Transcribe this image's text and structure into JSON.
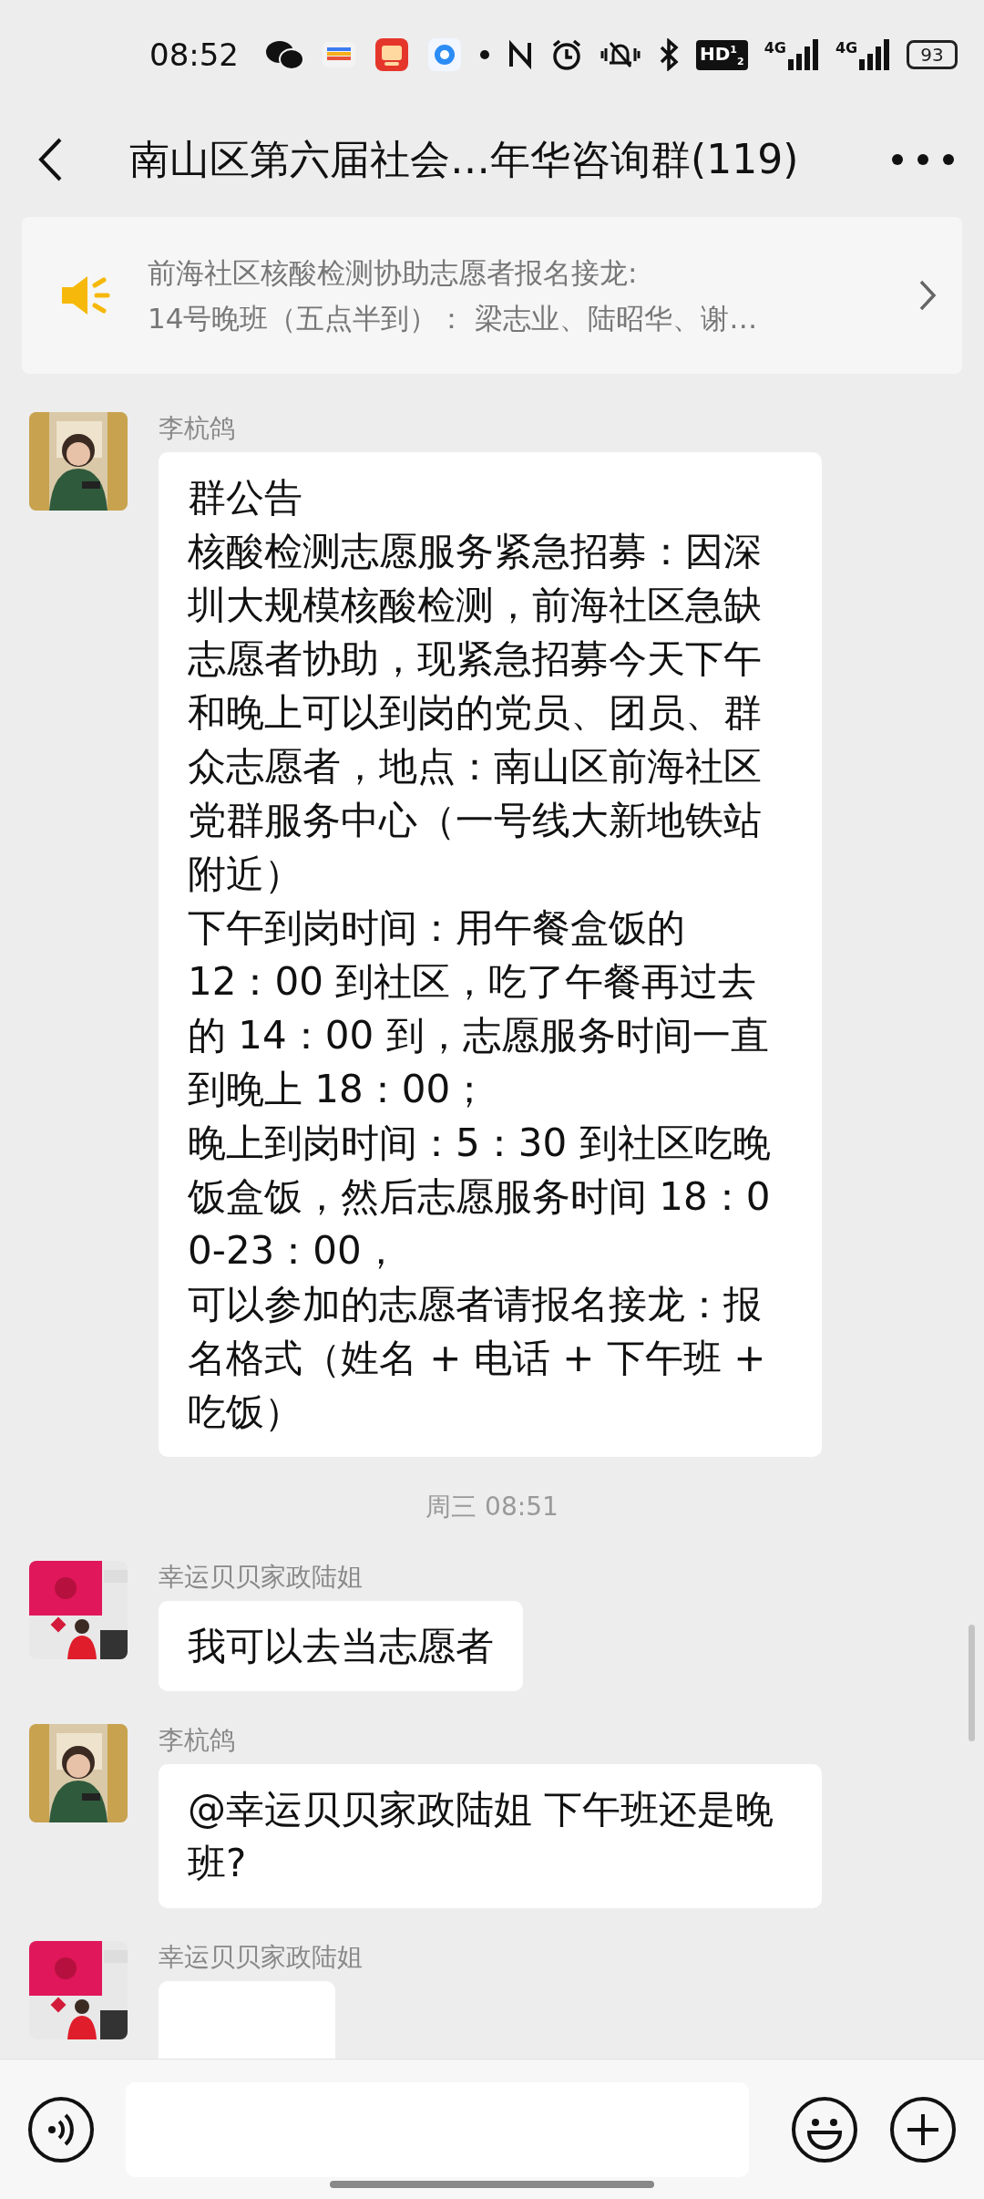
{
  "status_bar": {
    "time": "08:52",
    "hd": "HD$^{1}$$_{2}$",
    "signals": [
      "4G",
      "4G"
    ],
    "battery": "93"
  },
  "header": {
    "title": "南山区第六届社会…年华咨询群(119)"
  },
  "notice": {
    "lines": [
      "前海社区核酸检测协助志愿者报名接龙:",
      "14号晚班（五点半到）： 梁志业、陆昭华、谢…"
    ]
  },
  "messages": [
    {
      "kind": "message",
      "sender": "李杭鸽",
      "avatar": {
        "kind": "picture"
      },
      "paragraphs": [
        "群公告",
        "核酸检测志愿服务紧急招募：因深圳大规模核酸检测，前海社区急缺志愿者协助，现紧急招募今天下午和晚上可以到岗的党员、团员、群众志愿者，地点：南山区前海社区党群服务中心（一号线大新地铁站附近）",
        "下午到岗时间：用午餐盒饭的",
        "12：00 到社区，吃了午餐再过去的 14：00 到，志愿服务时间一直到晚上 18：00；",
        "晚上到岗时间：5：30 到社区吃晚饭盒饭，然后志愿服务时间 18：00-23：00，",
        "可以参加的志愿者请报名接龙：报名格式（姓名 + 电话 + 下午班 + 吃饭）"
      ]
    },
    {
      "kind": "timestamp",
      "text": "周三 08:51"
    },
    {
      "kind": "message",
      "sender": "幸运贝贝家政陆姐",
      "avatar": {
        "kind": "picture"
      },
      "paragraphs": [
        "我可以去当志愿者"
      ]
    },
    {
      "kind": "message",
      "sender": "李杭鸽",
      "avatar": {
        "kind": "picture"
      },
      "paragraphs": [
        "@幸运贝贝家政陆姐  下午班还是晚班?"
      ]
    },
    {
      "kind": "message",
      "sender": "幸运贝贝家政陆姐",
      "avatar": {
        "kind": "picture"
      }
    }
  ]
}
